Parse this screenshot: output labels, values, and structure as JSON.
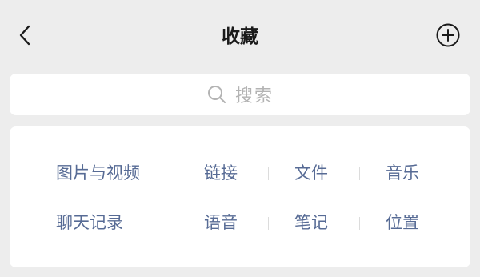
{
  "header": {
    "title": "收藏",
    "back_icon": "chevron-left-icon",
    "add_icon": "plus-circle-icon"
  },
  "search": {
    "placeholder": "搜索",
    "icon": "search-icon"
  },
  "categories": {
    "rows": [
      [
        "图片与视频",
        "链接",
        "文件",
        "音乐"
      ],
      [
        "聊天记录",
        "语音",
        "笔记",
        "位置"
      ]
    ],
    "link_color": "#576b95"
  },
  "colors": {
    "background": "#ededed",
    "card": "#ffffff",
    "title": "#1a1a1a",
    "placeholder": "#b3b3b3"
  }
}
